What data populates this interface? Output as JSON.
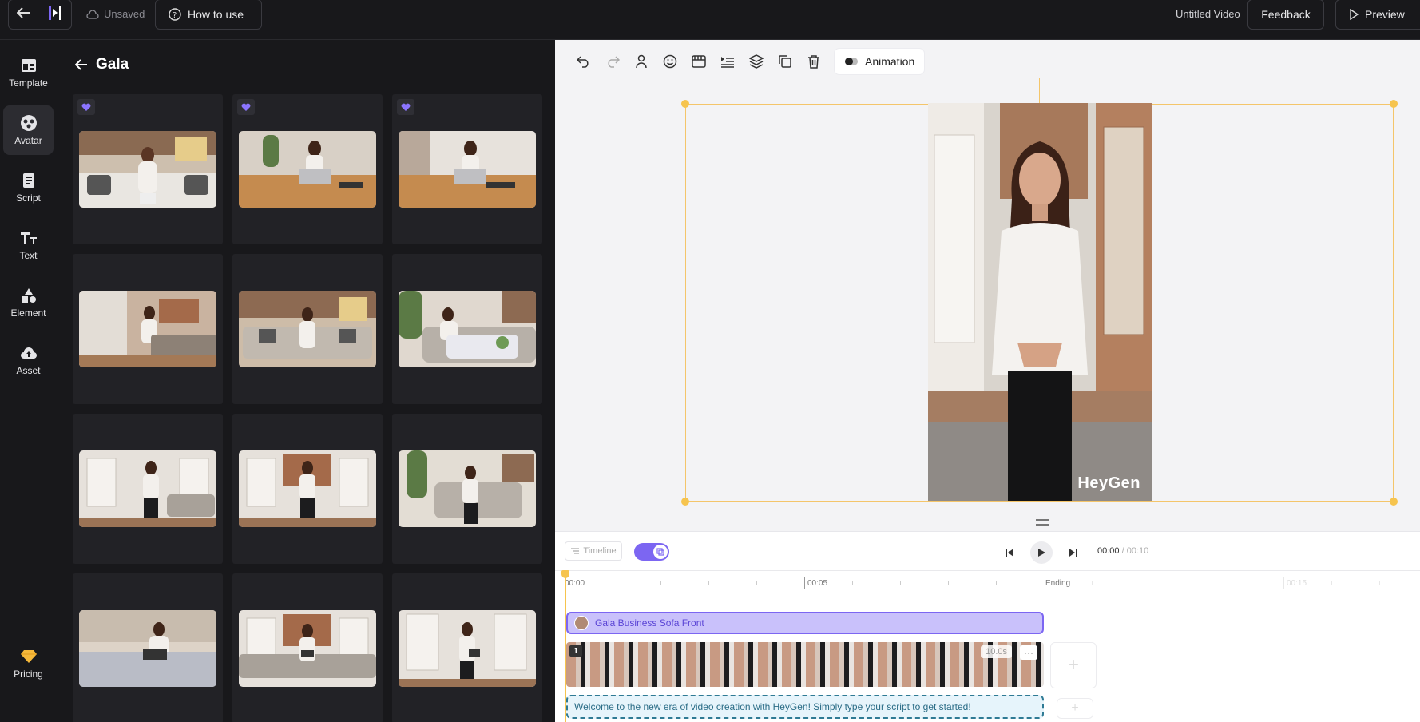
{
  "topbar": {
    "unsaved_label": "Unsaved",
    "how_to_use_label": "How to use",
    "video_title": "Untitled Video",
    "feedback_label": "Feedback",
    "preview_label": "Preview"
  },
  "nav": {
    "items": [
      {
        "label": "Template",
        "icon": "template-icon"
      },
      {
        "label": "Avatar",
        "icon": "avatar-icon",
        "active": true
      },
      {
        "label": "Script",
        "icon": "script-icon"
      },
      {
        "label": "Text",
        "icon": "text-icon"
      },
      {
        "label": "Element",
        "icon": "shapes-icon"
      },
      {
        "label": "Asset",
        "icon": "cloud-upload-icon"
      }
    ],
    "pricing_label": "Pricing"
  },
  "panel": {
    "title": "Gala",
    "favorited_cards": 3,
    "card_count": 12
  },
  "toolbar": {
    "animation_label": "Animation"
  },
  "stage": {
    "watermark": "HeyGen"
  },
  "timeline": {
    "timeline_label": "Timeline",
    "current_time": "00:00",
    "total_time": "/ 00:10",
    "ruler_labels": [
      "00:00",
      "00:05",
      "Ending",
      "00:15"
    ],
    "avatar_track_label": "Gala Business Sofa Front",
    "scene_number": "1",
    "scene_duration": "10.0s",
    "scene_more": "···",
    "script_text": "Welcome to the new era of video creation with HeyGen! Simply type your script to get started!"
  },
  "colors": {
    "accent": "#7c66f2",
    "selection": "#f6c44e",
    "dark_bg": "#18181b"
  }
}
